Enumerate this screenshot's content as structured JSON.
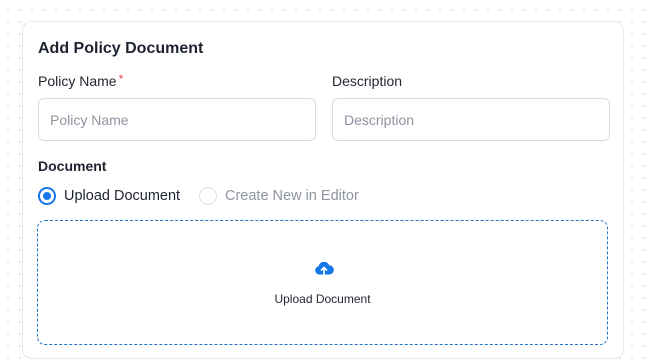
{
  "form": {
    "title": "Add Policy Document",
    "policy_name": {
      "label": "Policy Name",
      "required_mark": "*",
      "placeholder": "Policy Name",
      "value": ""
    },
    "description": {
      "label": "Description",
      "placeholder": "Description",
      "value": ""
    },
    "document": {
      "label": "Document",
      "options": [
        {
          "label": "Upload Document",
          "selected": true
        },
        {
          "label": "Create New in Editor",
          "selected": false
        }
      ],
      "dropzone": {
        "icon": "cloud-upload-icon",
        "label": "Upload Document"
      }
    }
  },
  "colors": {
    "accent": "#1677e8",
    "required": "#e5484d",
    "dropzone_border": "#1f73c8",
    "muted_text": "#8f95a0"
  }
}
